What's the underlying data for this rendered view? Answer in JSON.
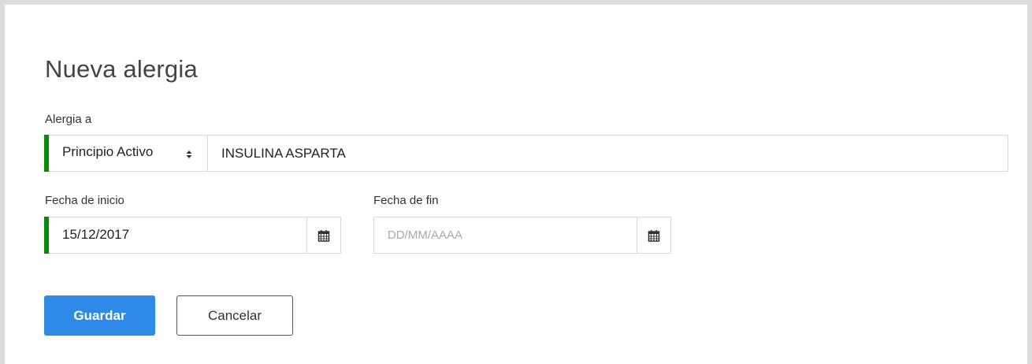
{
  "form": {
    "title": "Nueva alergia",
    "allergy_label": "Alergia a",
    "type_select": {
      "selected": "Principio Activo",
      "icon": "sort-icon"
    },
    "allergen_value": "INSULINA ASPARTA",
    "start_date": {
      "label": "Fecha de inicio",
      "value": "15/12/2017",
      "icon": "calendar-icon"
    },
    "end_date": {
      "label": "Fecha de fin",
      "value": "",
      "placeholder": "DD/MM/AAAA",
      "icon": "calendar-icon"
    },
    "save_label": "Guardar",
    "cancel_label": "Cancelar"
  },
  "colors": {
    "valid_indicator": "#0a8a0a",
    "primary_button": "#2e8ae6",
    "border": "#d9d9d9"
  }
}
